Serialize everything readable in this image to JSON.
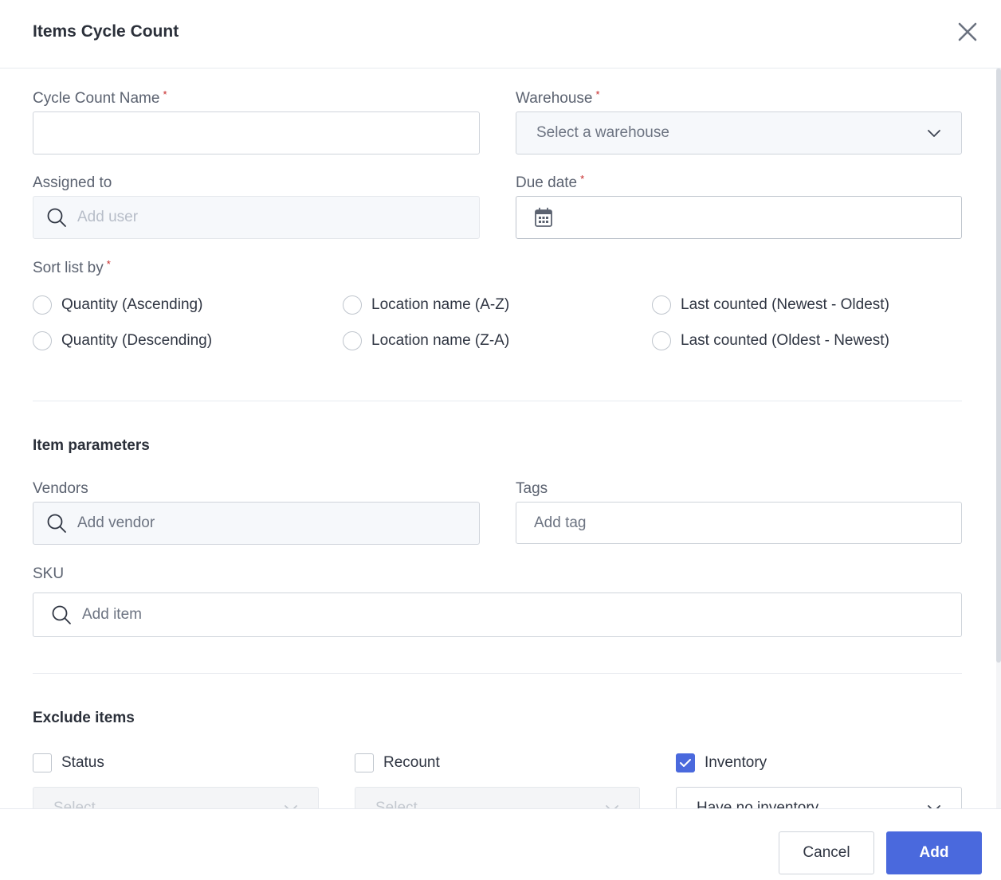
{
  "header": {
    "title": "Items Cycle Count"
  },
  "form": {
    "cycle_count_name": {
      "label": "Cycle Count Name",
      "required_mark": "*",
      "value": "",
      "placeholder": ""
    },
    "warehouse": {
      "label": "Warehouse",
      "required_mark": "*",
      "placeholder": "Select a warehouse"
    },
    "assigned_to": {
      "label": "Assigned to",
      "placeholder": "Add user"
    },
    "due_date": {
      "label": "Due date",
      "required_mark": "*",
      "value": ""
    },
    "sort_list_by": {
      "label": "Sort list by",
      "required_mark": "*",
      "options": [
        {
          "label": "Quantity (Ascending)",
          "selected": false
        },
        {
          "label": "Location name (A-Z)",
          "selected": false
        },
        {
          "label": "Last counted (Newest - Oldest)",
          "selected": false
        },
        {
          "label": "Quantity (Descending)",
          "selected": false
        },
        {
          "label": "Location name (Z-A)",
          "selected": false
        },
        {
          "label": "Last counted (Oldest - Newest)",
          "selected": false
        }
      ]
    }
  },
  "item_parameters": {
    "title": "Item parameters",
    "vendors": {
      "label": "Vendors",
      "placeholder": "Add vendor"
    },
    "tags": {
      "label": "Tags",
      "placeholder": "Add tag"
    },
    "sku": {
      "label": "SKU",
      "placeholder": "Add item"
    }
  },
  "exclude_items": {
    "title": "Exclude items",
    "status": {
      "label": "Status",
      "checked": false,
      "select_placeholder": "Select"
    },
    "recount": {
      "label": "Recount",
      "checked": false,
      "select_placeholder": "Select"
    },
    "inventory": {
      "label": "Inventory",
      "checked": true,
      "select_value": "Have no inventory"
    }
  },
  "footer": {
    "cancel_label": "Cancel",
    "add_label": "Add"
  },
  "colors": {
    "primary": "#4a69dd",
    "required": "#c62828",
    "border": "#cfd4db"
  }
}
